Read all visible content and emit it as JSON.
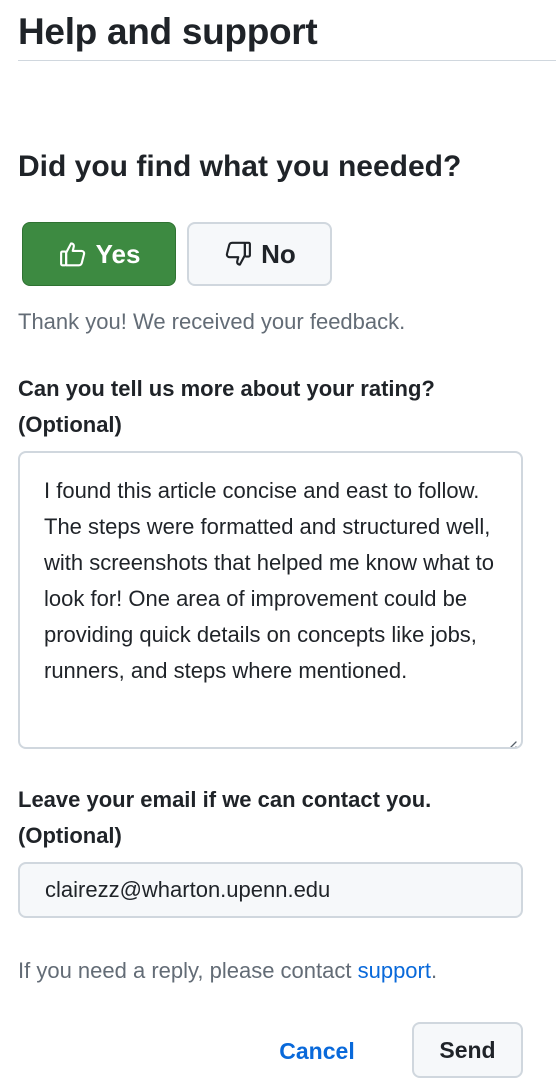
{
  "header": {
    "title": "Help and support"
  },
  "feedback": {
    "question": "Did you find what you needed?",
    "yes_label": "Yes",
    "no_label": "No",
    "selected": "yes",
    "accent_color": "#3d8a41",
    "thanks_message": "Thank you! We received your feedback."
  },
  "rating_details": {
    "label_line1": "Can you tell us more about your rating?",
    "label_line2": "(Optional)",
    "value": "I found this article concise and east to follow. The steps were formatted and structured well, with screenshots that helped me know what to look for! One area of improvement could be providing quick details on concepts like jobs, runners, and steps where mentioned."
  },
  "email": {
    "label_line1": "Leave your email if we can contact you.",
    "label_line2": "(Optional)",
    "value": "clairezz@wharton.upenn.edu"
  },
  "reply_note": {
    "prefix": "If you need a reply, please contact ",
    "link_text": "support",
    "suffix": ".",
    "link_color": "#0969da"
  },
  "actions": {
    "cancel_label": "Cancel",
    "send_label": "Send"
  },
  "icons": {
    "yes_icon": "thumbs-up-icon",
    "no_icon": "thumbs-down-icon"
  }
}
